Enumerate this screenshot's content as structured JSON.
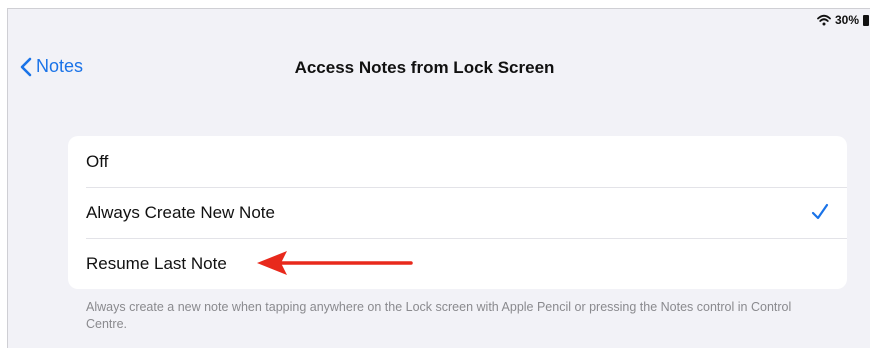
{
  "status_bar": {
    "wifi_icon": "wifi-icon",
    "battery_percent": "30%",
    "battery_icon": "battery-icon"
  },
  "nav": {
    "back_label": "Notes",
    "back_icon": "chevron-left-icon",
    "title": "Access Notes from Lock Screen"
  },
  "options": [
    {
      "label": "Off",
      "selected": false
    },
    {
      "label": "Always Create New Note",
      "selected": true
    },
    {
      "label": "Resume Last Note",
      "selected": false
    }
  ],
  "footer_text": "Always create a new note when tapping anywhere on the Lock screen with Apple Pencil or pressing the Notes control in Control Centre.",
  "colors": {
    "accent": "#1a73e8",
    "annotation_arrow": "#e8291c",
    "background": "#f2f2f7",
    "card": "#ffffff",
    "secondary_text": "#8a8a8e"
  }
}
